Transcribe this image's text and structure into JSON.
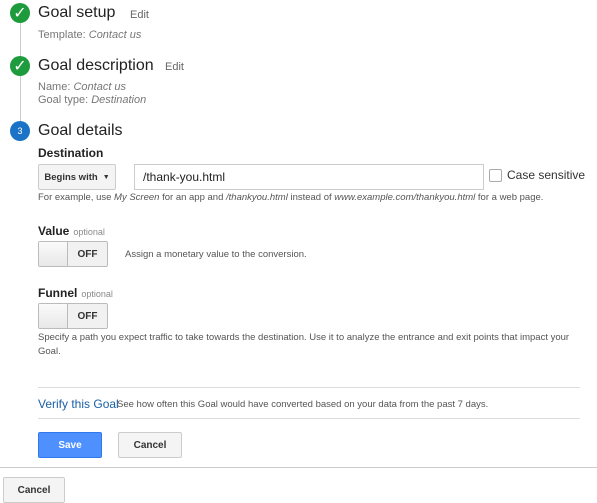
{
  "steps": [
    {
      "number": "1",
      "title": "Goal setup",
      "edit": "Edit",
      "lines": [
        {
          "label": "Template: ",
          "value": "Contact us"
        }
      ]
    },
    {
      "number": "2",
      "title": "Goal description",
      "edit": "Edit",
      "lines": [
        {
          "label": "Name: ",
          "value": "Contact us"
        },
        {
          "label": "Goal type: ",
          "value": "Destination"
        }
      ]
    },
    {
      "number": "3",
      "title": "Goal details"
    }
  ],
  "destination": {
    "label": "Destination",
    "match_type": "Begins with",
    "value": "/thank-you.html",
    "case_sensitive_label": "Case sensitive",
    "case_sensitive": false,
    "help": {
      "p1": "For example, use ",
      "e1": "My Screen",
      "p2": " for an app and ",
      "e2": "/thankyou.html",
      "p3": " instead of ",
      "e3": "www.example.com/thankyou.html",
      "p4": " for a web page."
    }
  },
  "value": {
    "label": "Value",
    "optional": "optional",
    "toggle": "OFF",
    "help": "Assign a monetary value to the conversion."
  },
  "funnel": {
    "label": "Funnel",
    "optional": "optional",
    "toggle": "OFF",
    "help": "Specify a path you expect traffic to take towards the destination. Use it to analyze the entrance and exit points that impact your Goal."
  },
  "verify": {
    "link": "Verify this Goal",
    "help": "See how often this Goal would have converted based on your data from the past 7 days."
  },
  "buttons": {
    "save": "Save",
    "cancel": "Cancel",
    "bottom_cancel": "Cancel"
  },
  "colors": {
    "check": "#1e9b3c",
    "step_active": "#1a73c6",
    "save": "#4d90fe",
    "link": "#1a5fa8"
  }
}
